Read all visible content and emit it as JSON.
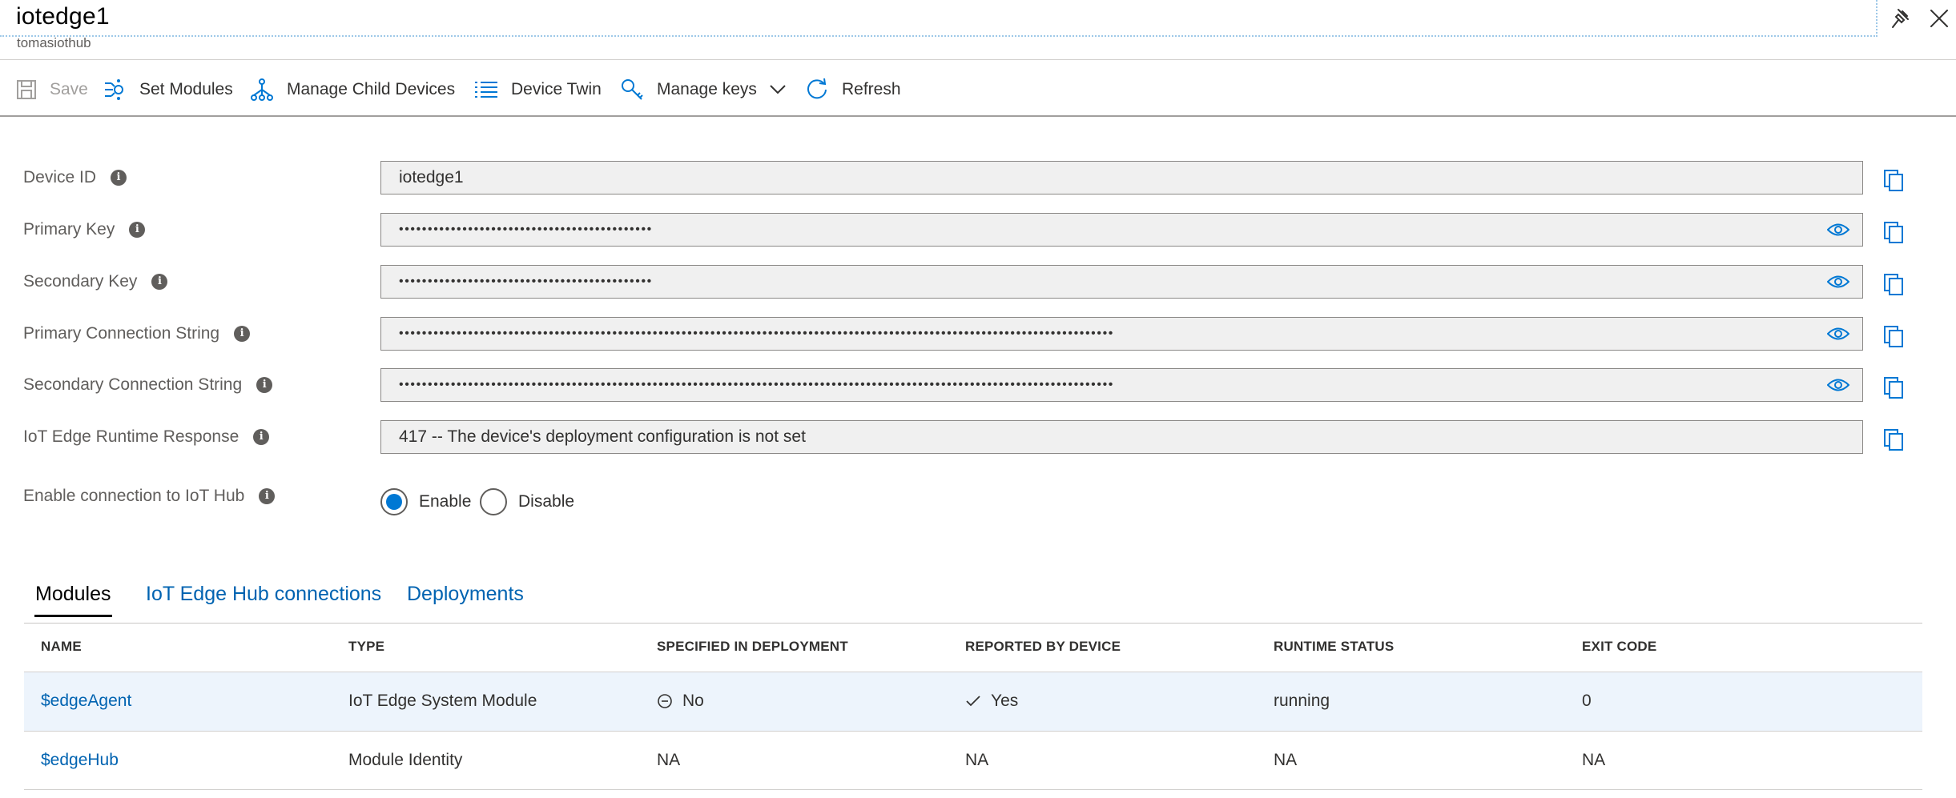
{
  "header": {
    "title": "iotedge1",
    "subtitle": "tomasiothub"
  },
  "toolbar": {
    "save": "Save",
    "set_modules": "Set Modules",
    "manage_child_devices": "Manage Child Devices",
    "device_twin": "Device Twin",
    "manage_keys": "Manage keys",
    "refresh": "Refresh"
  },
  "fields": {
    "device_id": {
      "label": "Device ID",
      "value": "iotedge1"
    },
    "primary_key": {
      "label": "Primary Key",
      "value": "••••••••••••••••••••••••••••••••••••••••••••"
    },
    "secondary_key": {
      "label": "Secondary Key",
      "value": "••••••••••••••••••••••••••••••••••••••••••••"
    },
    "primary_conn": {
      "label": "Primary Connection String",
      "value": "••••••••••••••••••••••••••••••••••••••••••••••••••••••••••••••••••••••••••••••••••••••••••••••••••••••••••••••••••••••••••••"
    },
    "secondary_conn": {
      "label": "Secondary Connection String",
      "value": "••••••••••••••••••••••••••••••••••••••••••••••••••••••••••••••••••••••••••••••••••••••••••••••••••••••••••••••••••••••••••••"
    },
    "runtime_response": {
      "label": "IoT Edge Runtime Response",
      "value": "417 -- The device's deployment configuration is not set"
    }
  },
  "connection": {
    "label": "Enable connection to IoT Hub",
    "enable": "Enable",
    "disable": "Disable",
    "selected": "Enable"
  },
  "tabs": [
    "Modules",
    "IoT Edge Hub connections",
    "Deployments"
  ],
  "active_tab": "Modules",
  "table": {
    "headers": [
      "NAME",
      "TYPE",
      "SPECIFIED IN DEPLOYMENT",
      "REPORTED BY DEVICE",
      "RUNTIME STATUS",
      "EXIT CODE"
    ],
    "rows": [
      {
        "name": "$edgeAgent",
        "type": "IoT Edge System Module",
        "specified": "No",
        "reported": "Yes",
        "runtime": "running",
        "exit": "0"
      },
      {
        "name": "$edgeHub",
        "type": "Module Identity",
        "specified": "NA",
        "reported": "NA",
        "runtime": "NA",
        "exit": "NA"
      }
    ]
  },
  "colors": {
    "accent": "#0078d4",
    "link": "#0063b1",
    "selected_row": "#edf4fc",
    "field_bg": "#f0f0f0"
  },
  "icons": [
    "pin-icon",
    "close-icon",
    "save-icon",
    "set-modules-icon",
    "child-devices-icon",
    "device-twin-icon",
    "key-icon",
    "chevron-down-icon",
    "refresh-icon",
    "info-icon",
    "eye-icon",
    "copy-icon",
    "minus-circle-icon",
    "checkmark-icon"
  ]
}
